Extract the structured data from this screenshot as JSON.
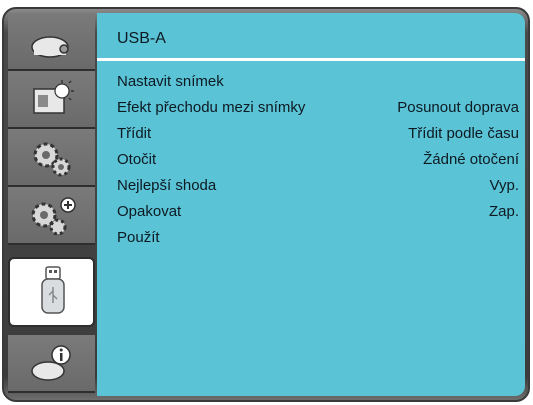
{
  "menu": {
    "title": "USB-A",
    "items": [
      {
        "label": "Nastavit snímek",
        "value": ""
      },
      {
        "label": "Efekt přechodu mezi snímky",
        "value": "Posunout doprava"
      },
      {
        "label": "Třídit",
        "value": "Třídit podle času"
      },
      {
        "label": "Otočit",
        "value": "Žádné otočení"
      },
      {
        "label": "Nejlepší shoda",
        "value": "Vyp."
      },
      {
        "label": "Opakovat",
        "value": "Zap."
      },
      {
        "label": "Použít",
        "value": ""
      }
    ]
  },
  "sidebar": {
    "items": [
      {
        "icon": "projector-icon"
      },
      {
        "icon": "image-settings-icon"
      },
      {
        "icon": "gears-icon"
      },
      {
        "icon": "advanced-gears-icon"
      },
      {
        "icon": "usb-drive-icon",
        "active": true
      },
      {
        "icon": "info-icon"
      }
    ]
  },
  "colors": {
    "panel": "#5bc3d6",
    "sidebar": "#6a6a6a",
    "text": "#0d1a22"
  }
}
